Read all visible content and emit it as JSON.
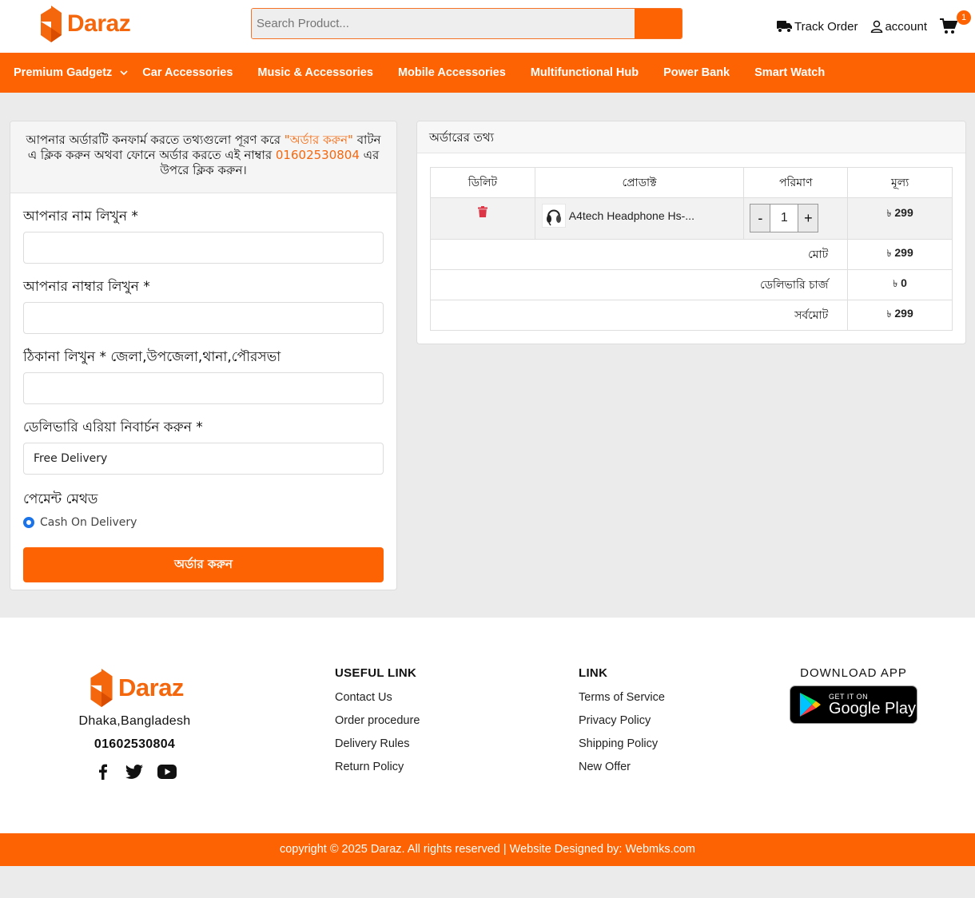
{
  "brand": {
    "name": "Daraz",
    "color": "#fd6303"
  },
  "search": {
    "placeholder": "Search Product..."
  },
  "header": {
    "track_order": "Track Order",
    "account": "account",
    "cart_count": "1"
  },
  "nav": {
    "items": [
      {
        "label": "Premium Gadgetz"
      },
      {
        "label": "Car Accessories"
      },
      {
        "label": "Music & Accessories"
      },
      {
        "label": "Mobile Accessories"
      },
      {
        "label": "Multifunctional Hub"
      },
      {
        "label": "Power Bank"
      },
      {
        "label": "Smart Watch"
      }
    ]
  },
  "form": {
    "notice_part1": "আপনার অর্ডারটি কনফার্ম করতে তথ্যগুলো পূরণ করে ",
    "notice_highlight": "\"অর্ডার করুন\"",
    "notice_part2": " বাটন এ ক্লিক করুন অথবা ফোনে অর্ডার করতে এই নাম্বার ",
    "notice_phone": "01602530804",
    "notice_part3": " এর উপরে ক্লিক করুন।",
    "name_label": "আপনার নাম লিখুন *",
    "phone_label": "আপনার নাম্বার লিখুন *",
    "address_label": "ঠিকানা লিখুন * জেলা,উপজেলা,থানা,পৌরসভা",
    "area_label": "ডেলিভারি এরিয়া নিবার্চন করুন *",
    "area_value": "Free Delivery",
    "payment_title": "পেমেন্ট মেথড",
    "payment_option": "Cash On Delivery",
    "submit_label": "অর্ডার করুন"
  },
  "order": {
    "title": "অর্ডারের তথ্য",
    "columns": [
      "ডিলিট",
      "প্রোডাক্ট",
      "পরিমাণ",
      "মূল্য"
    ],
    "item": {
      "name": "A4tech Headphone Hs-...",
      "qty": "1",
      "minus": "-",
      "plus": "+",
      "price": "299"
    },
    "currency": "৳",
    "subtotal_label": "মোট",
    "subtotal": "299",
    "delivery_label": "ডেলিভারি চার্জ",
    "delivery": "0",
    "total_label": "সর্বমোট",
    "total": "299"
  },
  "footer": {
    "address": "Dhaka,Bangladesh",
    "phone": "01602530804",
    "useful_title": "USEFUL LINK",
    "useful_links": [
      "Contact Us",
      "Order procedure",
      "Delivery Rules",
      "Return Policy"
    ],
    "link_title": "LINK",
    "links": [
      "Terms of Service",
      "Privacy Policy",
      "Shipping Policy",
      "New Offer"
    ],
    "download_title": "DOWNLOAD APP",
    "gplay_small": "GET IT ON",
    "gplay_big": "Google Play",
    "copyright": "copyright © 2025 Daraz. All rights reserved | Website Designed by: Webmks.com"
  }
}
